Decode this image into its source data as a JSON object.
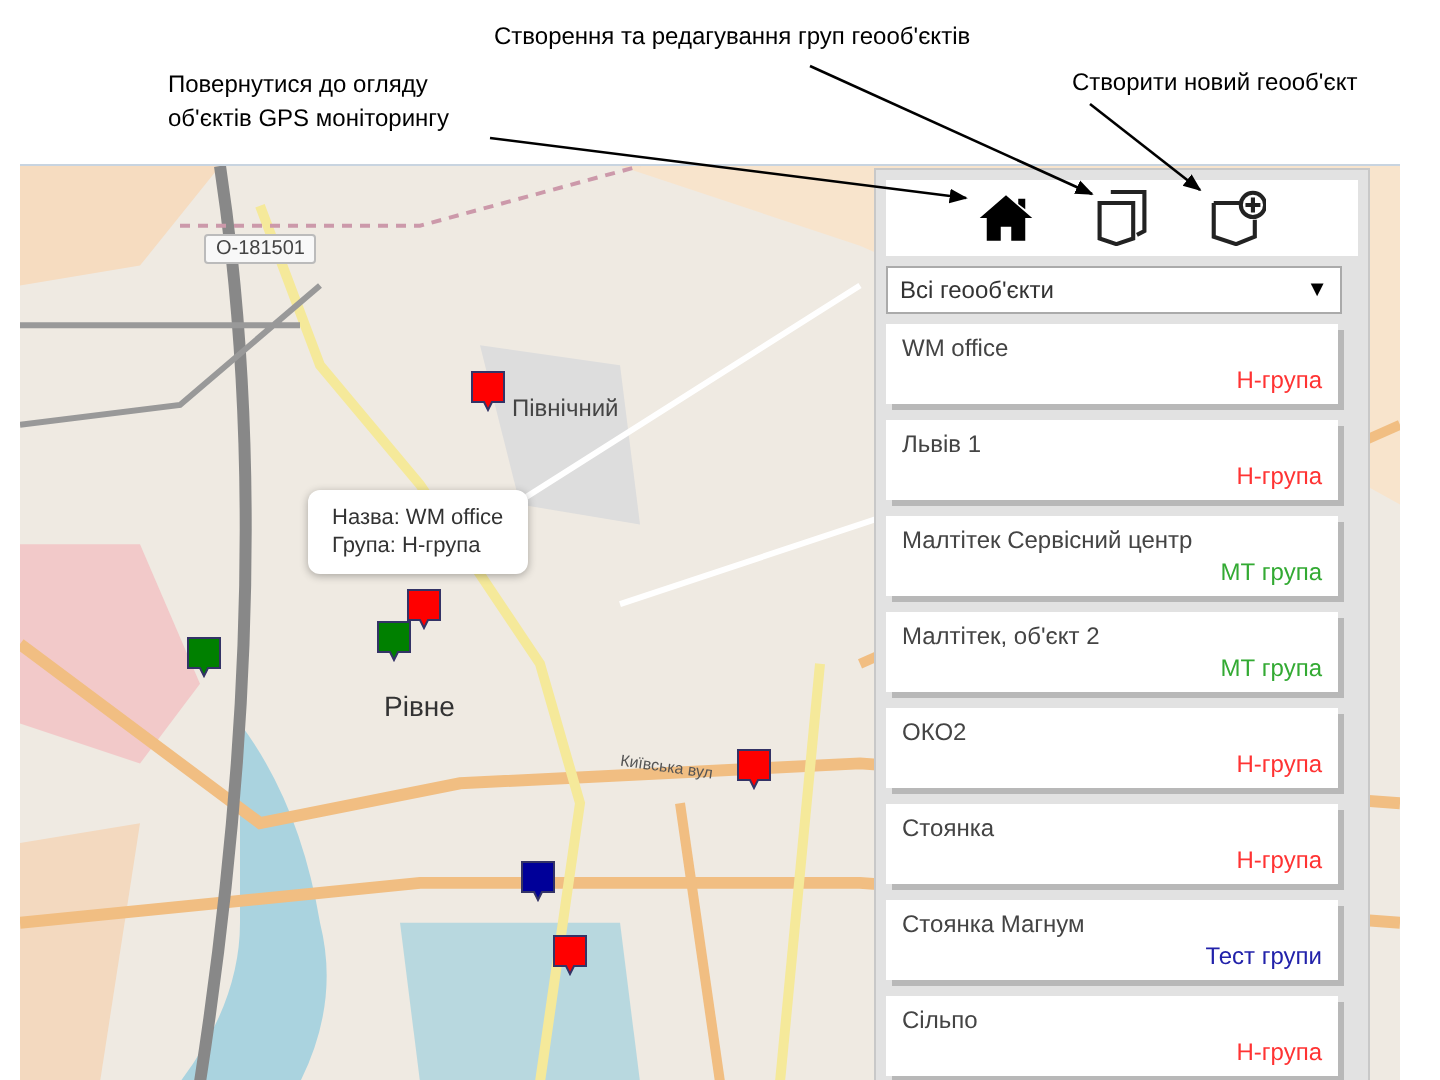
{
  "annotations": [
    {
      "text": "Створення та редагування груп геооб'єктів",
      "kind": "groups"
    },
    {
      "text": "Повернутися до огляду об'єктів GPS моніторингу",
      "kind": "home"
    },
    {
      "text": "Створити новий геооб'єкт",
      "kind": "create"
    }
  ],
  "map": {
    "labels": [
      {
        "text": "O-181501",
        "kind": "road-number"
      },
      {
        "text": "Північний",
        "kind": "district"
      },
      {
        "text": "Рівне",
        "kind": "city"
      },
      {
        "text": "Київська вул",
        "kind": "street"
      }
    ],
    "markers": [
      {
        "color": "#ff0000"
      },
      {
        "color": "#ff0000"
      },
      {
        "color": "#008000"
      },
      {
        "color": "#008000"
      },
      {
        "color": "#ff0000"
      },
      {
        "color": "#000099"
      },
      {
        "color": "#ff0000"
      }
    ],
    "popup": {
      "name_line": "Назва: WM office",
      "group_line": "Група: Н-група"
    }
  },
  "panel": {
    "filter": {
      "value": "Всі геооб'єкти",
      "arrow": "▼"
    },
    "items": [
      {
        "name": "WM office",
        "group": "Н-група",
        "color": "#ff3333"
      },
      {
        "name": "Львів 1",
        "group": "Н-група",
        "color": "#ff3333"
      },
      {
        "name": "Малтітек Сервісний центр",
        "group": "МТ група",
        "color": "#33aa33"
      },
      {
        "name": "Малтітек, об'єкт 2",
        "group": "МТ група",
        "color": "#33aa33"
      },
      {
        "name": "ОКО2",
        "group": "Н-група",
        "color": "#ff3333"
      },
      {
        "name": "Стоянка",
        "group": "Н-група",
        "color": "#ff3333"
      },
      {
        "name": "Стоянка Магнум",
        "group": "Тест групи",
        "color": "#2222aa"
      },
      {
        "name": "Сільпо",
        "group": "Н-група",
        "color": "#ff3333"
      }
    ]
  }
}
